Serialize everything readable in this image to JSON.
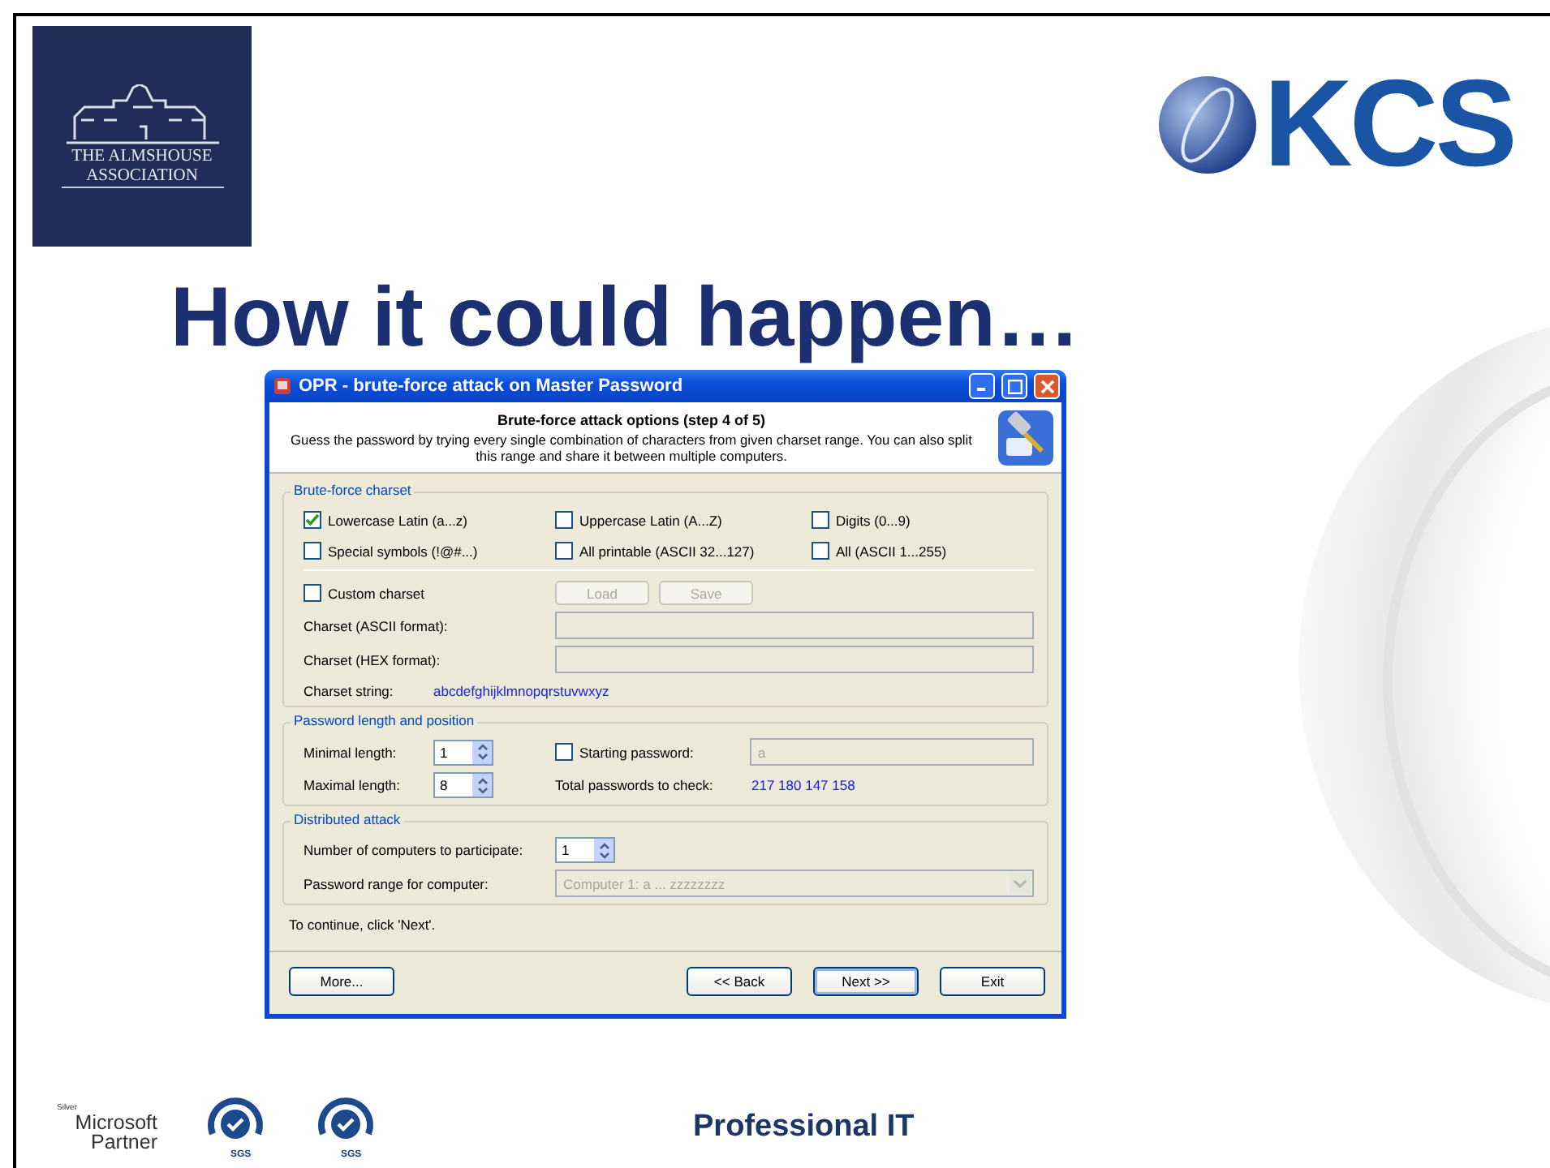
{
  "slide": {
    "title": "How it could happen…",
    "footer_text": "Professional IT"
  },
  "logos": {
    "association": [
      "THE ALMSHOUSE",
      "ASSOCIATION"
    ],
    "kcs": "KCS",
    "partner": {
      "tier": "Silver",
      "lines": [
        "Microsoft",
        "Partner"
      ]
    },
    "certifications": [
      {
        "label": "SGS"
      },
      {
        "label": "SGS"
      }
    ]
  },
  "dialog": {
    "title": "OPR - brute-force attack on Master Password",
    "header": {
      "heading": "Brute-force attack options (step 4 of 5)",
      "description": "Guess the password by trying every single combination of characters from given charset range. You can also split this range and share it between multiple computers."
    },
    "charset_group": {
      "legend": "Brute-force charset",
      "options": [
        {
          "label": "Lowercase Latin (a...z)",
          "checked": true
        },
        {
          "label": "Uppercase Latin (A...Z)",
          "checked": false
        },
        {
          "label": "Digits (0...9)",
          "checked": false
        },
        {
          "label": "Special symbols (!@#...)",
          "checked": false
        },
        {
          "label": "All printable (ASCII 32...127)",
          "checked": false
        },
        {
          "label": "All (ASCII 1...255)",
          "checked": false
        }
      ],
      "custom": {
        "label": "Custom charset",
        "checked": false
      },
      "buttons": [
        {
          "label": "Load",
          "disabled": true
        },
        {
          "label": "Save",
          "disabled": true
        }
      ],
      "fields": [
        {
          "label": "Charset (ASCII format):",
          "disabled": true
        },
        {
          "label": "Charset (HEX format):",
          "disabled": true
        }
      ],
      "charset_string": {
        "label": "Charset string:",
        "value": "abcdefghijklmnopqrstuvwxyz"
      }
    },
    "length_group": {
      "legend": "Password length and position",
      "minimal": {
        "label": "Minimal length:",
        "value": "1"
      },
      "maximal": {
        "label": "Maximal length:",
        "value": "8"
      },
      "starting": {
        "label": "Starting password:",
        "checked": false,
        "value": "a"
      },
      "total": {
        "label": "Total passwords to check:",
        "value": "217 180 147 158"
      }
    },
    "distributed_group": {
      "legend": "Distributed attack",
      "computers": {
        "label": "Number of computers to participate:",
        "value": "1"
      },
      "range": {
        "label": "Password range for computer:",
        "value": "Computer  1:  a ... zzzzzzzz",
        "disabled": true
      }
    },
    "status": "To continue, click 'Next'.",
    "buttons": [
      {
        "label": "More...",
        "default": false
      },
      {
        "label": "<< Back",
        "default": false
      },
      {
        "label": "Next >>",
        "default": true
      },
      {
        "label": "Exit",
        "default": false
      }
    ]
  }
}
